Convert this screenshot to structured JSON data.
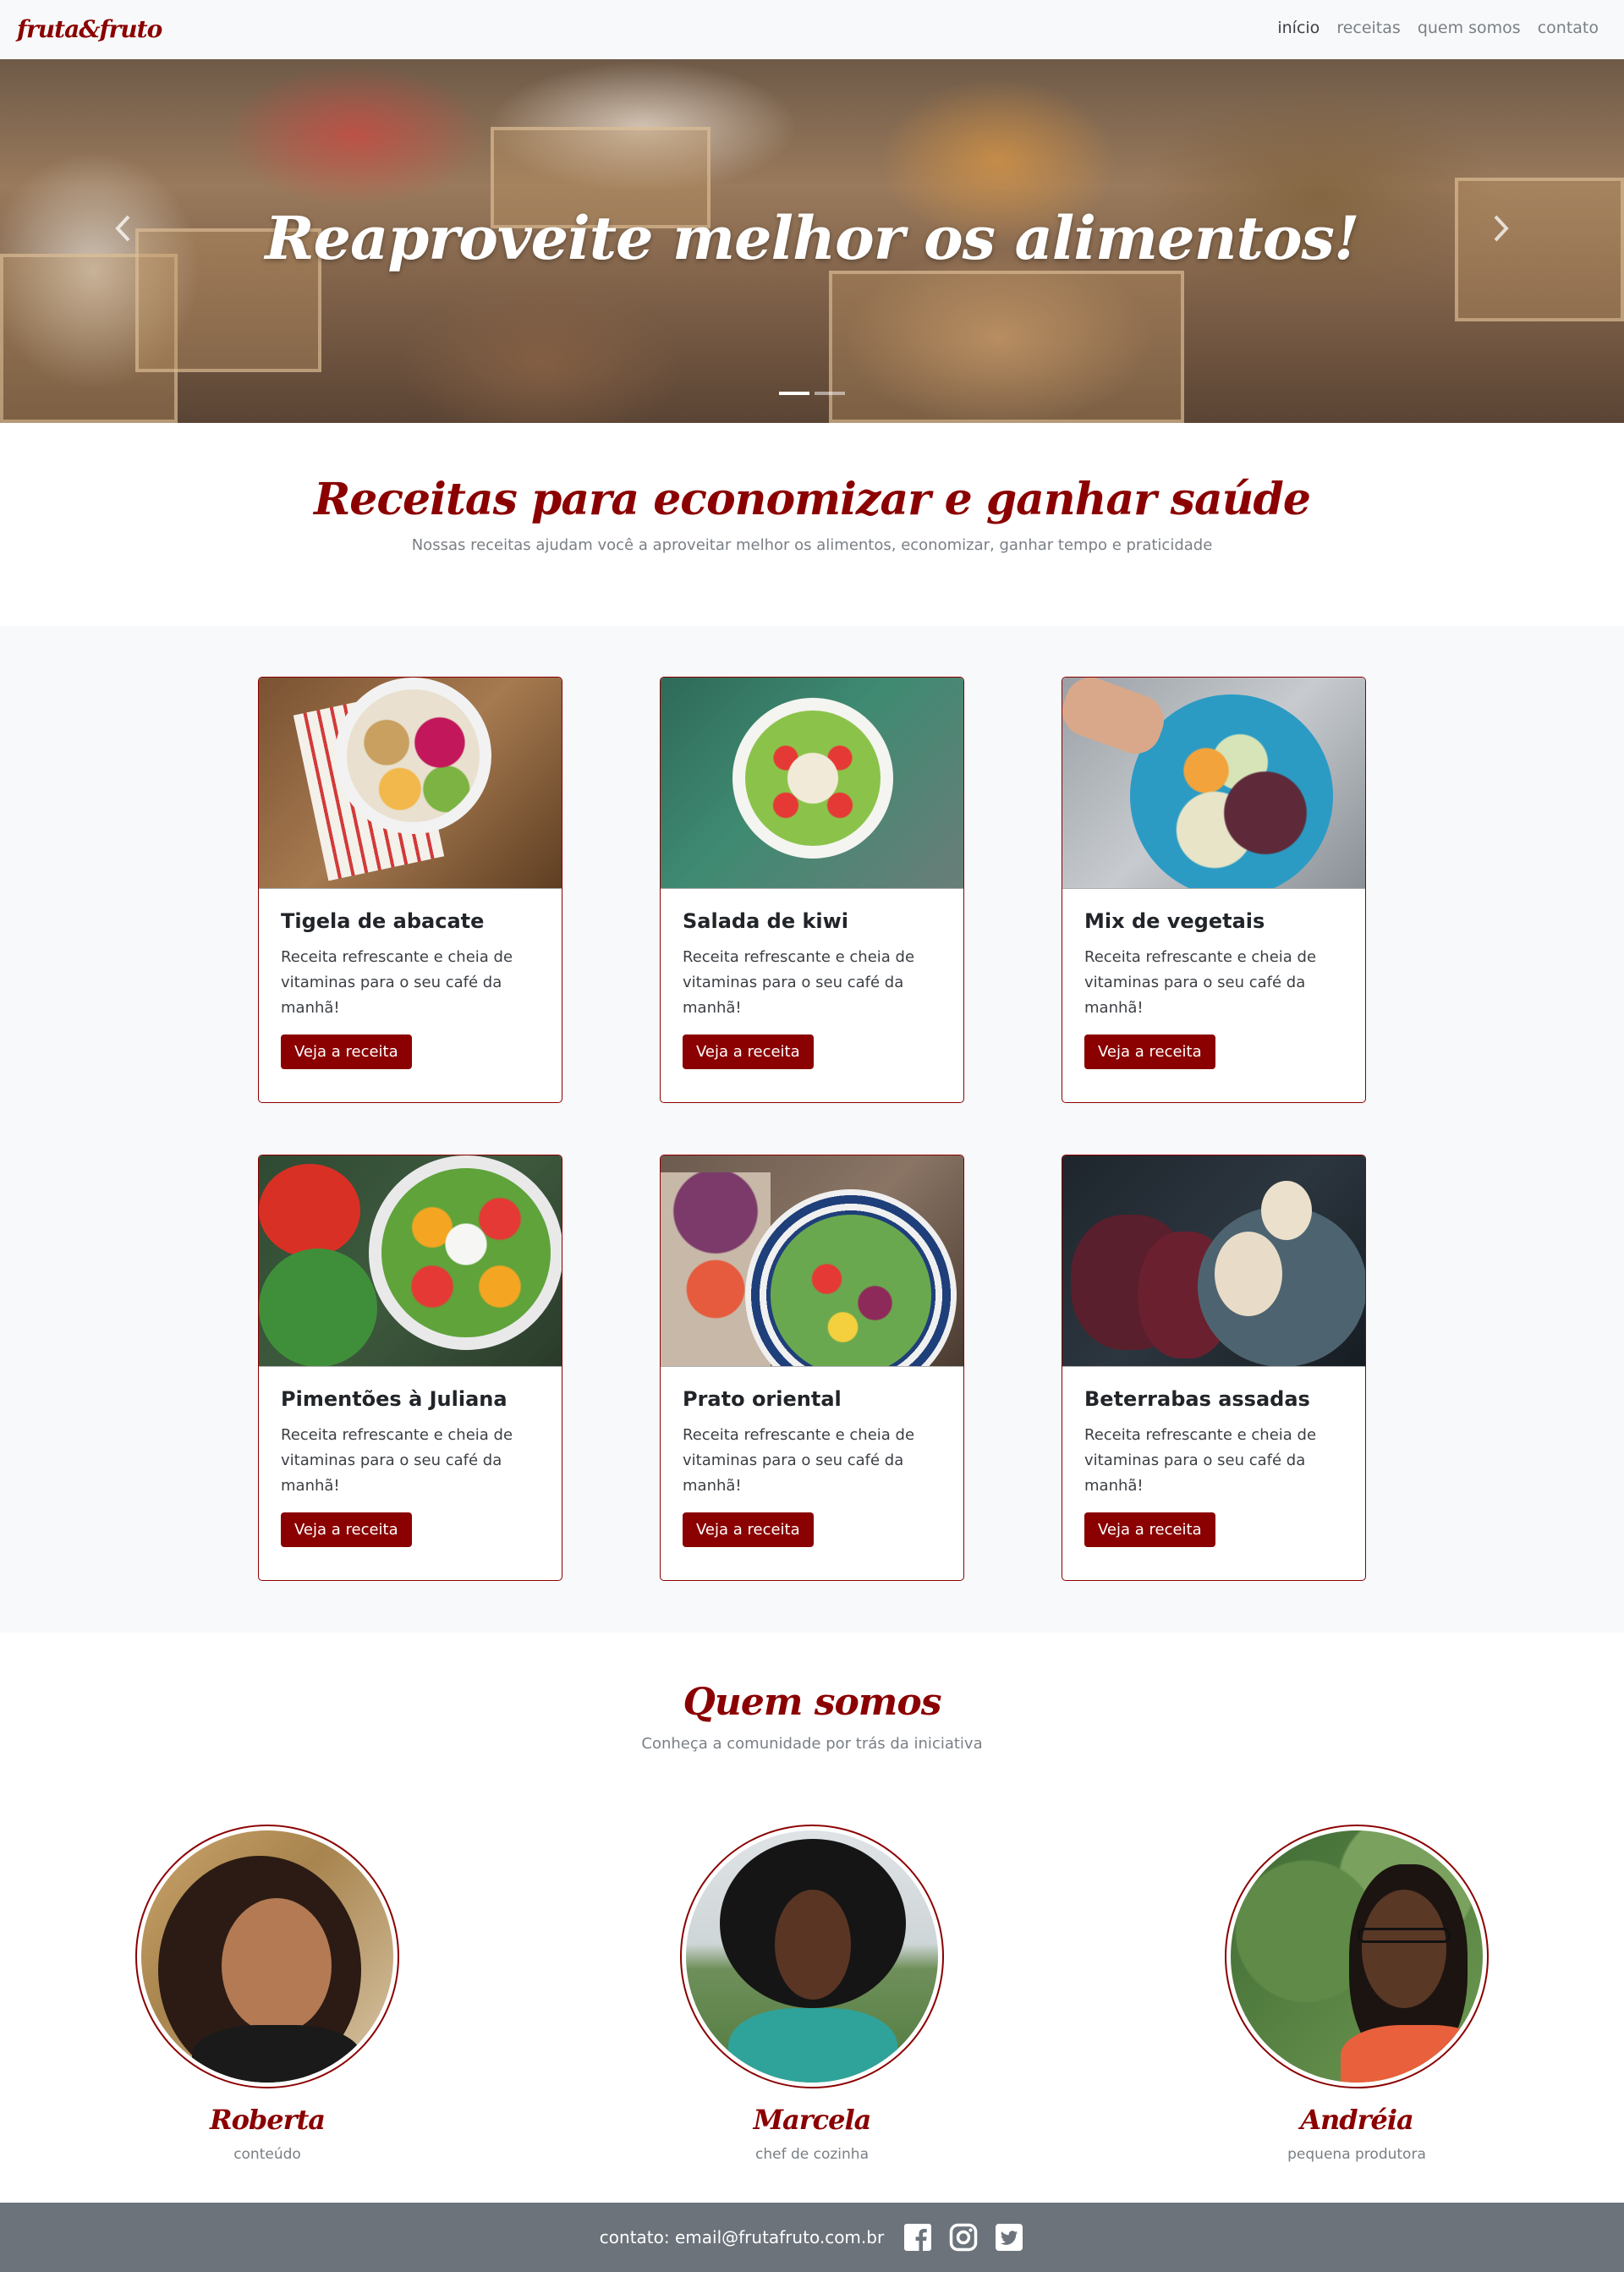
{
  "navbar": {
    "brand": "fruta&fruto",
    "links": [
      {
        "label": "início"
      },
      {
        "label": "receitas"
      },
      {
        "label": "quem somos"
      },
      {
        "label": "contato"
      }
    ]
  },
  "hero": {
    "title": "Reaproveite melhor os alimentos!",
    "slides": 2,
    "active_slide": 1
  },
  "recipes_section": {
    "title": "Receitas para economizar e ganhar saúde",
    "subtitle": "Nossas receitas ajudam você a aproveitar melhor os alimentos, economizar, ganhar tempo e praticidade"
  },
  "recipes": [
    {
      "title": "Tigela de abacate",
      "text": "Receita refrescante e cheia de vitaminas para o seu café da manhã!",
      "button": "Veja a receita"
    },
    {
      "title": "Salada de kiwi",
      "text": "Receita refrescante e cheia de vitaminas para o seu café da manhã!",
      "button": "Veja a receita"
    },
    {
      "title": "Mix de vegetais",
      "text": "Receita refrescante e cheia de vitaminas para o seu café da manhã!",
      "button": "Veja a receita"
    },
    {
      "title": "Pimentões à Juliana",
      "text": "Receita refrescante e cheia de vitaminas para o seu café da manhã!",
      "button": "Veja a receita"
    },
    {
      "title": "Prato oriental",
      "text": "Receita refrescante e cheia de vitaminas para o seu café da manhã!",
      "button": "Veja a receita"
    },
    {
      "title": "Beterrabas assadas",
      "text": "Receita refrescante e cheia de vitaminas para o seu café da manhã!",
      "button": "Veja a receita"
    }
  ],
  "team_section": {
    "title": "Quem somos",
    "subtitle": "Conheça a comunidade por trás da iniciativa"
  },
  "team": [
    {
      "name": "Roberta",
      "role": "conteúdo"
    },
    {
      "name": "Marcela",
      "role": "chef de cozinha"
    },
    {
      "name": "Andréia",
      "role": "pequena produtora"
    }
  ],
  "footer": {
    "contact": "contato: email@frutafruto.com.br",
    "social_icons": [
      "facebook-icon",
      "instagram-icon",
      "twitter-icon"
    ]
  },
  "colors": {
    "accent": "#8b0000",
    "navbar_bg": "#f8f9fa",
    "footer_bg": "#6c737b",
    "muted_text": "#7a7f85"
  }
}
